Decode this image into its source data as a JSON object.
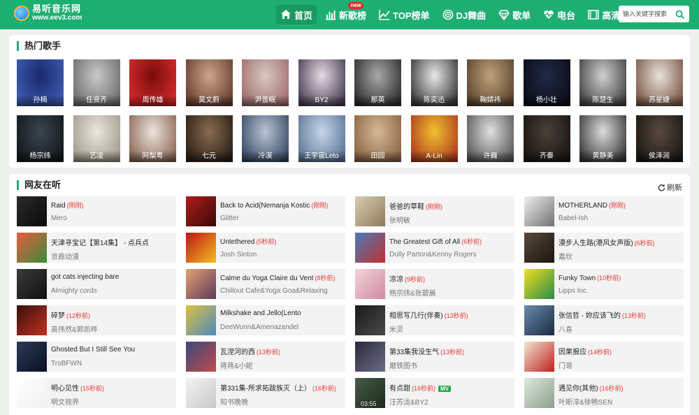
{
  "site": {
    "title": "易听音乐网",
    "url": "www.eev3.com"
  },
  "nav": [
    {
      "label": "首页",
      "icon": "home-icon",
      "active": true
    },
    {
      "label": "新歌榜",
      "icon": "bar-chart-icon",
      "badge": "new"
    },
    {
      "label": "TOP榜单",
      "icon": "trend-line-icon"
    },
    {
      "label": "DJ舞曲",
      "icon": "disc-icon"
    },
    {
      "label": "歌单",
      "icon": "diamond-icon"
    },
    {
      "label": "电台",
      "icon": "heartbeat-icon"
    },
    {
      "label": "高清MV",
      "icon": "film-icon"
    }
  ],
  "search": {
    "placeholder": "输入关键字搜索"
  },
  "hot_singers": {
    "title": "热门歌手",
    "items": [
      {
        "name": "孙楠",
        "bg": [
          "#1a2a6c",
          "#3d5ab0"
        ]
      },
      {
        "name": "任贤齐",
        "bg": [
          "#c9c9c9",
          "#6e6e6e"
        ]
      },
      {
        "name": "周传雄",
        "bg": [
          "#7a0c0c",
          "#d22b2b"
        ]
      },
      {
        "name": "莫文蔚",
        "bg": [
          "#caa58a",
          "#6a4030"
        ]
      },
      {
        "name": "尹昔眠",
        "bg": [
          "#d8c8c0",
          "#a07070"
        ]
      },
      {
        "name": "BY2",
        "bg": [
          "#e3dce3",
          "#4c3f55"
        ]
      },
      {
        "name": "那英",
        "bg": [
          "#a9a9a9",
          "#2f2f2f"
        ]
      },
      {
        "name": "陈奕迅",
        "bg": [
          "#e8e8e8",
          "#3a3a3a"
        ]
      },
      {
        "name": "鞠婧祎",
        "bg": [
          "#bfa27a",
          "#5c4630"
        ]
      },
      {
        "name": "杨小壮",
        "bg": [
          "#1e2a48",
          "#0d0d16"
        ]
      },
      {
        "name": "陈楚生",
        "bg": [
          "#d0d0d0",
          "#454545"
        ]
      },
      {
        "name": "苏星婕",
        "bg": [
          "#e9e2da",
          "#7c5a48"
        ]
      },
      {
        "name": "杨宗纬",
        "bg": [
          "#3a4550",
          "#14181c"
        ]
      },
      {
        "name": "艺凌",
        "bg": [
          "#eae7e0",
          "#a59c8e"
        ]
      },
      {
        "name": "阿梨粤",
        "bg": [
          "#ece4dd",
          "#8e6a58"
        ]
      },
      {
        "name": "七元",
        "bg": [
          "#8a6c50",
          "#2c2018"
        ]
      },
      {
        "name": "冷漠",
        "bg": [
          "#b8c4d4",
          "#3a4c66"
        ]
      },
      {
        "name": "王宇宙Leto",
        "bg": [
          "#c7d6ea",
          "#5d7797"
        ]
      },
      {
        "name": "田园",
        "bg": [
          "#d6b894",
          "#8c6848"
        ]
      },
      {
        "name": "A-Lin",
        "bg": [
          "#f0c030",
          "#b04020"
        ]
      },
      {
        "name": "许巍",
        "bg": [
          "#e0e0e0",
          "#5a5a5a"
        ]
      },
      {
        "name": "齐秦",
        "bg": [
          "#4a4038",
          "#1a1612"
        ]
      },
      {
        "name": "黄静美",
        "bg": [
          "#dcdcdc",
          "#3c3c3c"
        ]
      },
      {
        "name": "侯泽润",
        "bg": [
          "#5a4a40",
          "#1c1814"
        ]
      }
    ]
  },
  "listening": {
    "title": "网友在听",
    "refresh": "刷新",
    "songs": [
      {
        "title": "Raid",
        "ago": "(刚刚)",
        "artist": "Mero",
        "bg": [
          "#2a2a2a",
          "#0a0a0a"
        ]
      },
      {
        "title": "Back to Acid(Nemanja Kostic",
        "ago": "(刚刚)",
        "artist": "Glitter",
        "bg": [
          "#b01c1c",
          "#3a0808"
        ]
      },
      {
        "title": "爸爸的草鞋",
        "ago": "(刚刚)",
        "artist": "张明敏",
        "bg": [
          "#d9cdb4",
          "#8e7a58"
        ]
      },
      {
        "title": "MOTHERLAND",
        "ago": "(刚刚)",
        "artist": "Babel-Ish",
        "bg": [
          "#f0f0f0",
          "#707070"
        ]
      },
      {
        "title": "天津寻宝记【第14集】 - 点兵点",
        "ago": "",
        "artist": "京鼎动漫",
        "bg": [
          "#e85c3c",
          "#3a8c3c"
        ]
      },
      {
        "title": "Untethered",
        "ago": "(5秒前)",
        "artist": "Josh Sinton",
        "bg": [
          "#c01414",
          "#f0c020"
        ]
      },
      {
        "title": "The Greatest Gift of All",
        "ago": "(6秒前)",
        "artist": "Dolly Parton&Kenny Rogers",
        "bg": [
          "#4a7ab8",
          "#c23030"
        ]
      },
      {
        "title": "漫步人生路(港风女声版)",
        "ago": "(6秒前)",
        "artist": "嘉欣",
        "bg": [
          "#5a4a3a",
          "#1a1410"
        ]
      },
      {
        "title": "got cats injecting bare",
        "ago": "",
        "artist": "Almighty cords",
        "bg": [
          "#3a3a3a",
          "#101010"
        ]
      },
      {
        "title": "Calme du Yoga Claire du Vent",
        "ago": "(8秒前)",
        "artist": "Chillout Cafe&Yoga Goa&Relaxing",
        "bg": [
          "#e8a070",
          "#5a3a5a"
        ]
      },
      {
        "title": "凉凉",
        "ago": "(9秒前)",
        "artist": "杨宗纬&张碧晨",
        "bg": [
          "#f4d4dc",
          "#d08aa0"
        ]
      },
      {
        "title": "Funky Town",
        "ago": "(10秒前)",
        "artist": "Lipps Inc.",
        "bg": [
          "#f0e020",
          "#2a8a4a"
        ]
      },
      {
        "title": "碎梦",
        "ago": "(12秒前)",
        "artist": "高伟然&郭凯晔",
        "bg": [
          "#3a1010",
          "#c03020"
        ]
      },
      {
        "title": "Milkshake and Jello(Lento",
        "ago": "",
        "artist": "DeeWunn&Amenazandel",
        "bg": [
          "#e0c040",
          "#4a8ac0"
        ]
      },
      {
        "title": "相思写几行(伴奏)",
        "ago": "(13秒前)",
        "artist": "米灵",
        "bg": [
          "#1a1a1a",
          "#4a4a4a"
        ]
      },
      {
        "title": "张信哲 - 妳应该飞的",
        "ago": "(13秒前)",
        "artist": "八喜",
        "bg": [
          "#6a8ab0",
          "#1a2a40"
        ]
      },
      {
        "title": "Ghosted But I Still See You",
        "ago": "",
        "artist": "TroBFWN",
        "bg": [
          "#2a3a5a",
          "#0a1020"
        ]
      },
      {
        "title": "瓦涅河的西",
        "ago": "(13秒前)",
        "artist": "蒋蒋&小妮",
        "bg": [
          "#3a4a7a",
          "#c04a4a"
        ]
      },
      {
        "title": "第33集我没生气",
        "ago": "(13秒前)",
        "artist": "磨铁图书",
        "bg": [
          "#2a2a3a",
          "#6a6a8a"
        ]
      },
      {
        "title": "因果报应",
        "ago": "(14秒前)",
        "artist": "门哥",
        "bg": [
          "#f0e8d0",
          "#c02020"
        ]
      },
      {
        "title": "明心见性",
        "ago": "(15秒前)",
        "artist": "明文视界",
        "bg": [
          "#ffffff",
          "#f0f0f0"
        ]
      },
      {
        "title": "第331集-所求拓跋族灭（上）",
        "ago": "(16秒前)",
        "artist": "知书晚晚",
        "bg": [
          "#f4f4f4",
          "#c8c8c8"
        ]
      },
      {
        "title": "有点甜",
        "ago": "(16秒前)",
        "artist": "汪苏泷&BY2",
        "bg": [
          "#4a5a4a",
          "#1a2a1a"
        ],
        "mv": "MV",
        "duration": "03:55"
      },
      {
        "title": "遇见你(其他)",
        "ago": "(16秒前)",
        "artist": "叶斯淳&徐畅SEN",
        "bg": [
          "#e0e8e0",
          "#8aa08a"
        ]
      }
    ]
  }
}
